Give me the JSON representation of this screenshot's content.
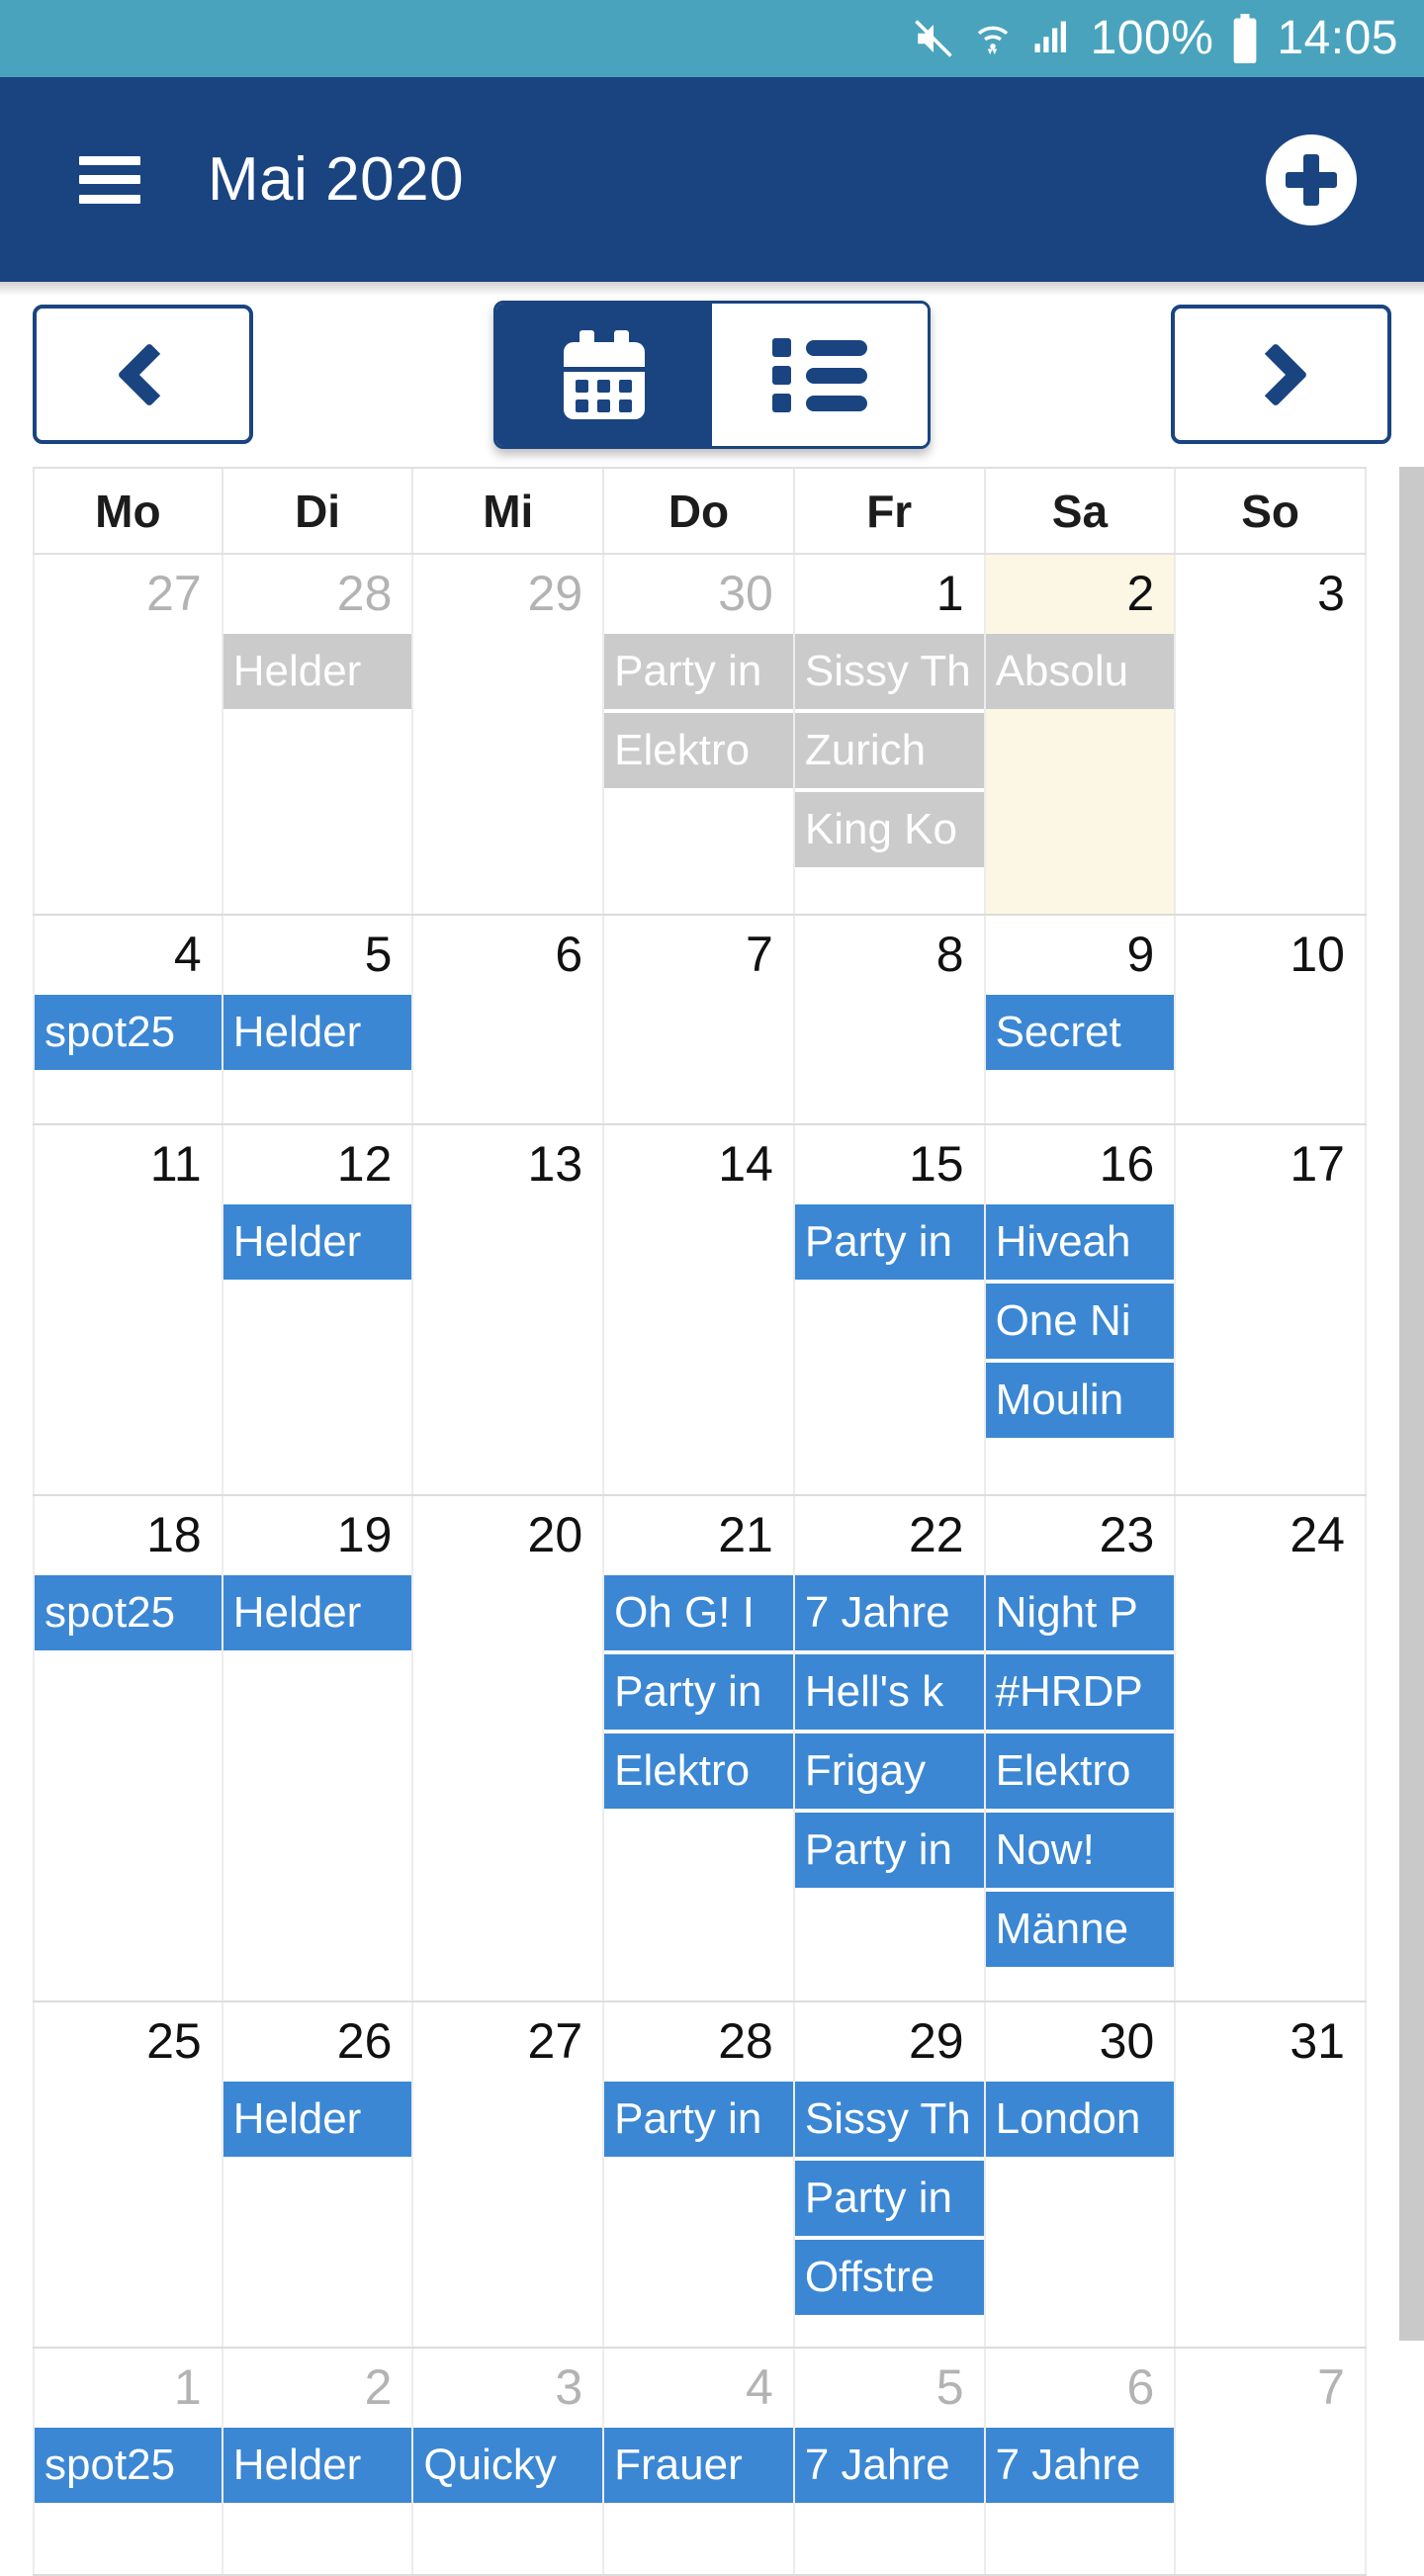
{
  "statusbar": {
    "icons": [
      "mute-icon",
      "wifi-icon",
      "signal-icon"
    ],
    "battery_percent": "100%",
    "time": "14:05"
  },
  "appbar": {
    "menu_icon": "hamburger-menu-icon",
    "title": "Mai 2020",
    "add_icon": "plus-icon"
  },
  "toolbar": {
    "prev_label": "chevron-left-icon",
    "next_label": "chevron-right-icon",
    "views": [
      {
        "name": "calendar-view",
        "icon": "calendar-icon",
        "active": true
      },
      {
        "name": "list-view",
        "icon": "list-icon",
        "active": false
      }
    ]
  },
  "colors": {
    "statusbar": "#4aa3bd",
    "appbar": "#1a4480",
    "accent": "#1a4480",
    "event_chip": "#3b87d4",
    "event_chip_past": "#cbcbcb",
    "today_highlight": "#fbf7e4",
    "other_month_text": "#b3b3b3"
  },
  "calendar": {
    "weekdays": [
      "Mo",
      "Di",
      "Mi",
      "Do",
      "Fr",
      "Sa",
      "So"
    ],
    "weeks": [
      [
        {
          "day": "27",
          "other_month": true,
          "today": false,
          "events": []
        },
        {
          "day": "28",
          "other_month": true,
          "today": false,
          "events": [
            "Helder"
          ]
        },
        {
          "day": "29",
          "other_month": true,
          "today": false,
          "events": []
        },
        {
          "day": "30",
          "other_month": true,
          "today": false,
          "events": [
            "Party in",
            "Elektro"
          ]
        },
        {
          "day": "1",
          "other_month": false,
          "today": false,
          "events": [
            "Sissy Th",
            "Zurich",
            "King Ko"
          ]
        },
        {
          "day": "2",
          "other_month": false,
          "today": true,
          "events": [
            "Absolu"
          ]
        },
        {
          "day": "3",
          "other_month": false,
          "today": false,
          "events": []
        }
      ],
      [
        {
          "day": "4",
          "other_month": false,
          "today": false,
          "events": [
            "spot25"
          ]
        },
        {
          "day": "5",
          "other_month": false,
          "today": false,
          "events": [
            "Helder"
          ]
        },
        {
          "day": "6",
          "other_month": false,
          "today": false,
          "events": []
        },
        {
          "day": "7",
          "other_month": false,
          "today": false,
          "events": []
        },
        {
          "day": "8",
          "other_month": false,
          "today": false,
          "events": []
        },
        {
          "day": "9",
          "other_month": false,
          "today": false,
          "events": [
            "Secret"
          ]
        },
        {
          "day": "10",
          "other_month": false,
          "today": false,
          "events": []
        }
      ],
      [
        {
          "day": "11",
          "other_month": false,
          "today": false,
          "events": []
        },
        {
          "day": "12",
          "other_month": false,
          "today": false,
          "events": [
            "Helder"
          ]
        },
        {
          "day": "13",
          "other_month": false,
          "today": false,
          "events": []
        },
        {
          "day": "14",
          "other_month": false,
          "today": false,
          "events": []
        },
        {
          "day": "15",
          "other_month": false,
          "today": false,
          "events": [
            "Party in"
          ]
        },
        {
          "day": "16",
          "other_month": false,
          "today": false,
          "events": [
            "Hiveah",
            "One Ni",
            "Moulin"
          ]
        },
        {
          "day": "17",
          "other_month": false,
          "today": false,
          "events": []
        }
      ],
      [
        {
          "day": "18",
          "other_month": false,
          "today": false,
          "events": [
            "spot25"
          ]
        },
        {
          "day": "19",
          "other_month": false,
          "today": false,
          "events": [
            "Helder"
          ]
        },
        {
          "day": "20",
          "other_month": false,
          "today": false,
          "events": []
        },
        {
          "day": "21",
          "other_month": false,
          "today": false,
          "events": [
            "Oh G! I",
            "Party in",
            "Elektro"
          ]
        },
        {
          "day": "22",
          "other_month": false,
          "today": false,
          "events": [
            "7 Jahre",
            "Hell's k",
            "Frigay",
            "Party in"
          ]
        },
        {
          "day": "23",
          "other_month": false,
          "today": false,
          "events": [
            "Night P",
            "#HRDP",
            "Elektro",
            "Now!",
            "Männe"
          ]
        },
        {
          "day": "24",
          "other_month": false,
          "today": false,
          "events": []
        }
      ],
      [
        {
          "day": "25",
          "other_month": false,
          "today": false,
          "events": []
        },
        {
          "day": "26",
          "other_month": false,
          "today": false,
          "events": [
            "Helder"
          ]
        },
        {
          "day": "27",
          "other_month": false,
          "today": false,
          "events": []
        },
        {
          "day": "28",
          "other_month": false,
          "today": false,
          "events": [
            "Party in"
          ]
        },
        {
          "day": "29",
          "other_month": false,
          "today": false,
          "events": [
            "Sissy Th",
            "Party in",
            "Offstre"
          ]
        },
        {
          "day": "30",
          "other_month": false,
          "today": false,
          "events": [
            "London"
          ]
        },
        {
          "day": "31",
          "other_month": false,
          "today": false,
          "events": []
        }
      ],
      [
        {
          "day": "1",
          "other_month": true,
          "today": false,
          "events": [
            "spot25"
          ]
        },
        {
          "day": "2",
          "other_month": true,
          "today": false,
          "events": [
            "Helder"
          ]
        },
        {
          "day": "3",
          "other_month": true,
          "today": false,
          "events": [
            "Quicky"
          ]
        },
        {
          "day": "4",
          "other_month": true,
          "today": false,
          "events": [
            "Frauer"
          ]
        },
        {
          "day": "5",
          "other_month": true,
          "today": false,
          "events": [
            "7 Jahre"
          ]
        },
        {
          "day": "6",
          "other_month": true,
          "today": false,
          "events": [
            "7 Jahre"
          ]
        },
        {
          "day": "7",
          "other_month": true,
          "today": false,
          "events": []
        }
      ]
    ]
  }
}
